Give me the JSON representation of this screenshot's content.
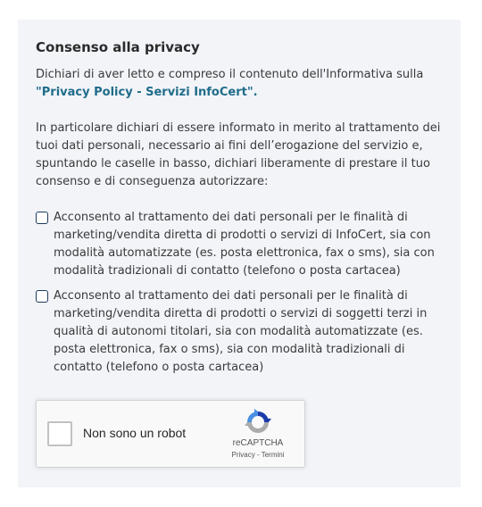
{
  "privacy": {
    "title": "Consenso alla privacy",
    "intro_text": "Dichiari di aver letto e compreso il contenuto dell'Informativa sulla ",
    "intro_link": "\"Privacy Policy - Servizi InfoCert\".",
    "detail_text": "In particolare dichiari di essere informato in merito al trattamento dei tuoi dati personali, necessario ai fini dell’erogazione del servizio e, spuntando le caselle in basso, dichiari liberamente di prestare il tuo consenso e di conseguenza autorizzare:",
    "consents": [
      {
        "label": "Acconsento al trattamento dei dati personali per le finalità di marketing/vendita diretta di prodotti o servizi di InfoCert, sia con modalità automatizzate (es. posta elettronica, fax o sms), sia con modalità tradizionali di contatto (telefono o posta cartacea)",
        "checked": false
      },
      {
        "label": "Acconsento al trattamento dei dati personali per le finalità di marketing/vendita diretta di prodotti o servizi di soggetti terzi in qualità di autonomi titolari, sia con modalità automatizzate (es. posta elettronica, fax o sms), sia con modalità tradizionali di contatto (telefono o posta cartacea)",
        "checked": false
      }
    ]
  },
  "recaptcha": {
    "label": "Non sono un robot",
    "brand": "reCAPTCHA",
    "privacy_link": "Privacy",
    "separator": " - ",
    "terms_link": "Termini",
    "checked": false,
    "icon": "recaptcha-logo-icon"
  },
  "colors": {
    "panel_background": "#f2f4f8",
    "link": "#1f6c8a",
    "checkbox_border": "#1e3a5f",
    "recaptcha_blue": "#4a90e2",
    "recaptcha_dark_blue": "#1c3aa9",
    "recaptcha_gray": "#ababab"
  }
}
